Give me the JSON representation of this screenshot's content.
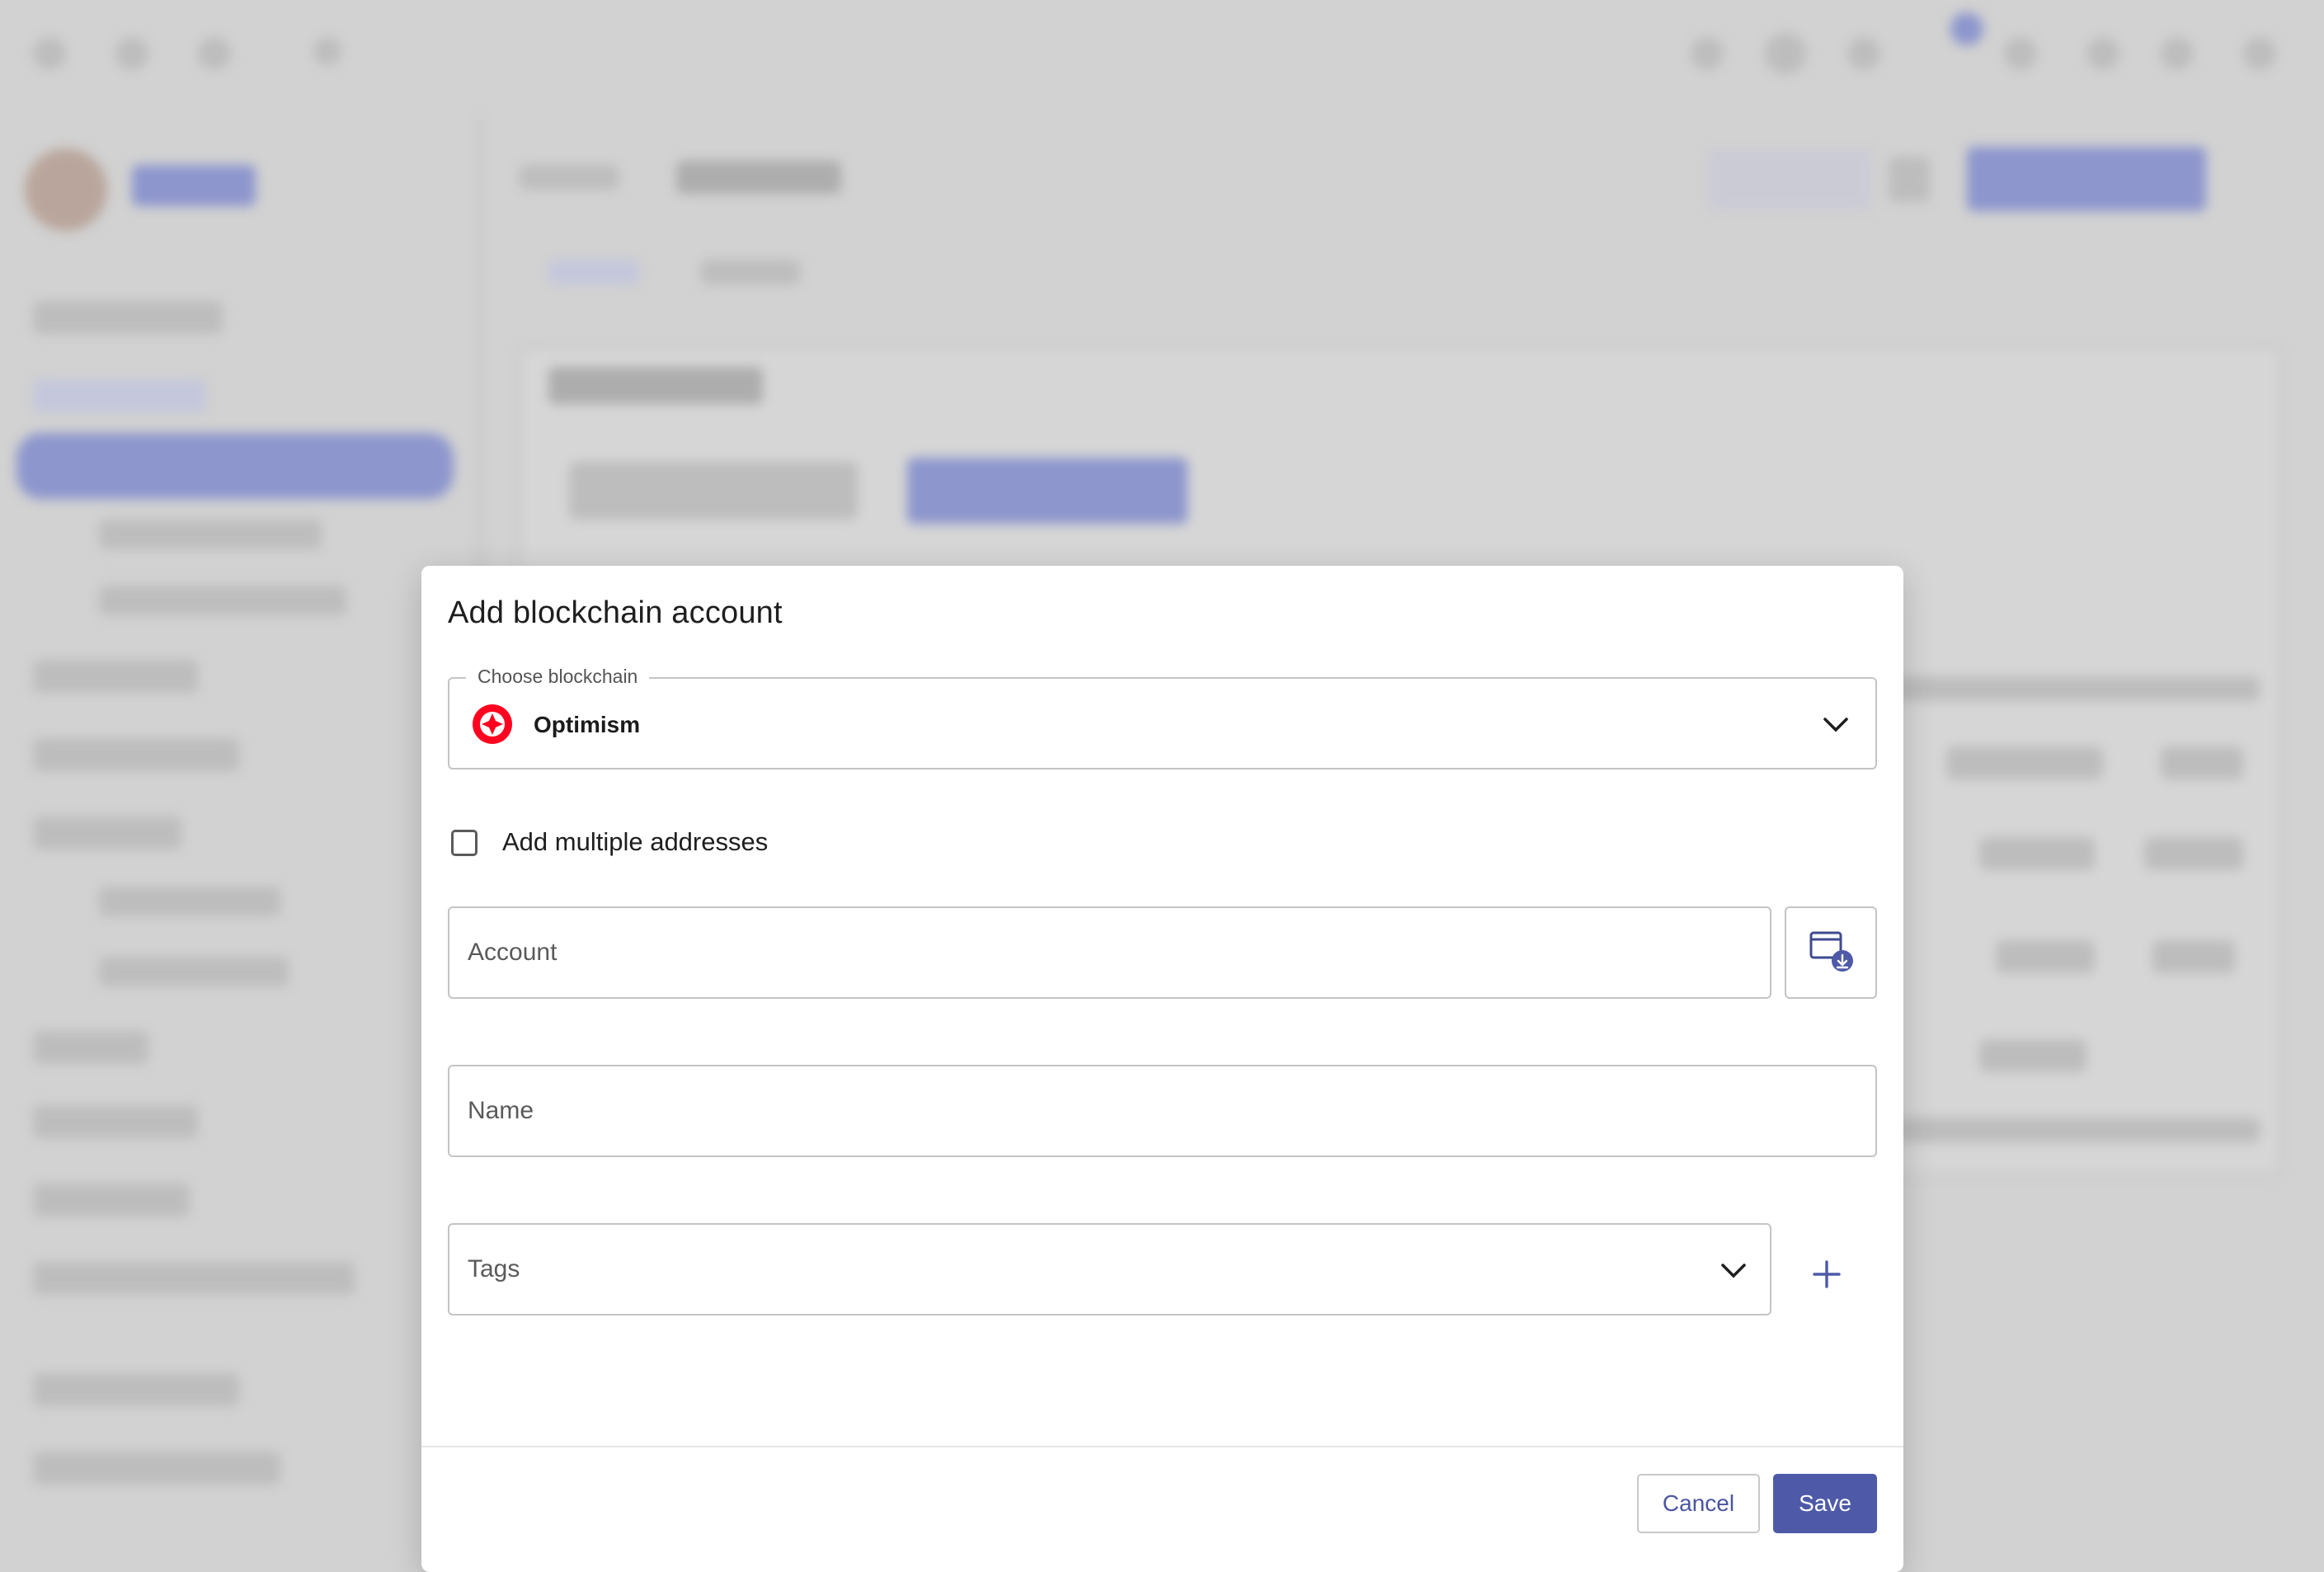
{
  "dialog": {
    "title": "Add blockchain account",
    "blockchain": {
      "label": "Choose blockchain",
      "selected": "Optimism"
    },
    "multiple": {
      "label": "Add multiple addresses",
      "checked": false
    },
    "account": {
      "placeholder": "Account"
    },
    "name": {
      "placeholder": "Name"
    },
    "tags": {
      "placeholder": "Tags"
    },
    "buttons": {
      "cancel": "Cancel",
      "save": "Save"
    }
  },
  "colors": {
    "primary": "#4e5aa8",
    "optimism": "#ff0420",
    "overlay": "#d2d2d2"
  },
  "icons": {
    "dropdown": "chevron-down-icon",
    "import": "wallet-import-icon",
    "add_tag": "plus-icon",
    "chain_logo": "optimism-logo"
  }
}
